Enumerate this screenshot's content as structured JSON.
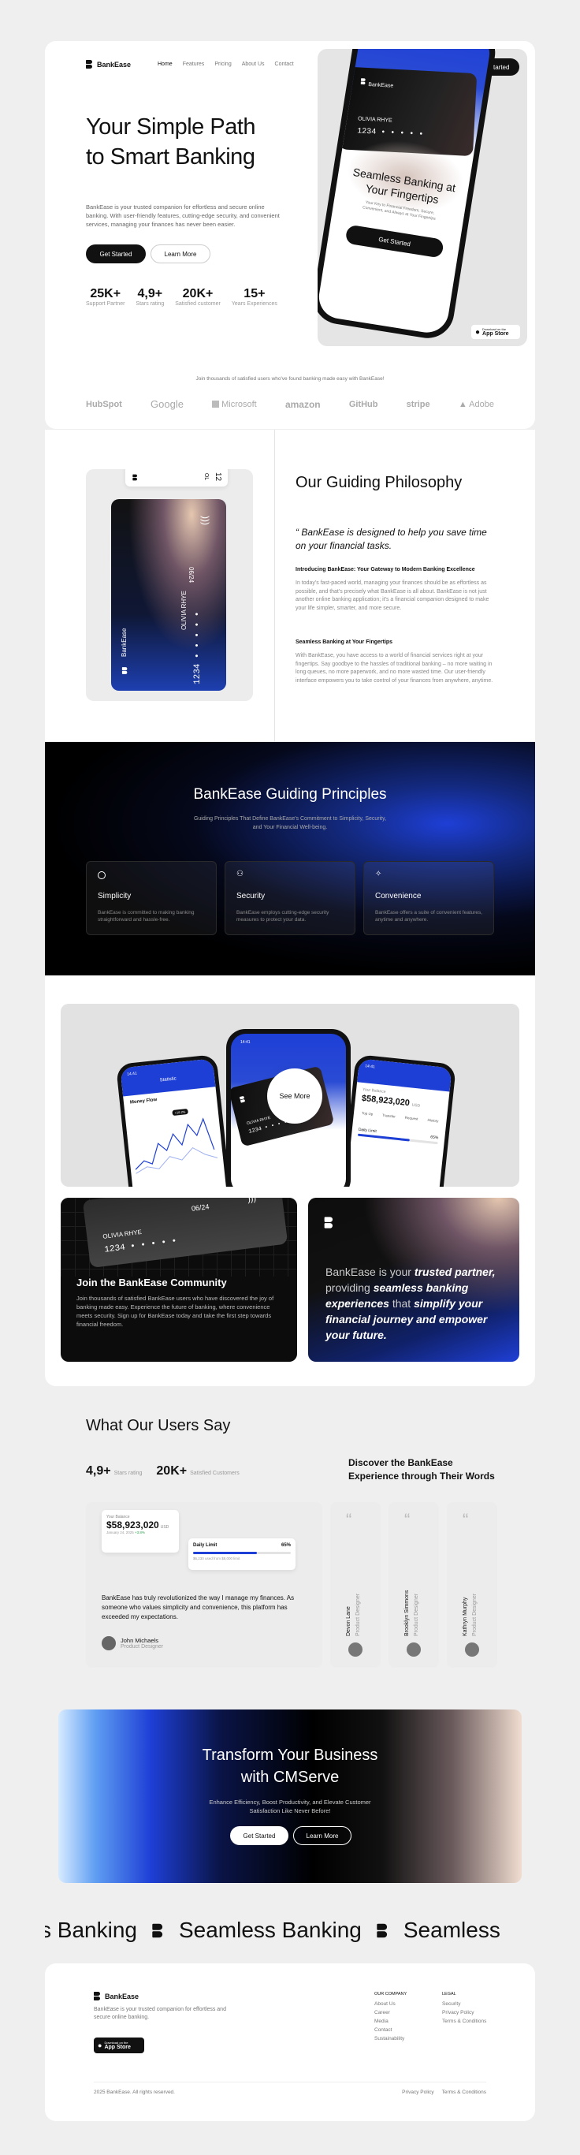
{
  "nav": {
    "brand": "BankEase",
    "links": [
      "Home",
      "Features",
      "Pricing",
      "About Us",
      "Contact"
    ],
    "cta": "Get Started"
  },
  "hero": {
    "title_line1": "Your Simple Path",
    "title_line2": "to Smart Banking",
    "desc": "BankEase is your trusted companion for effortless and secure online banking. With user-friendly features, cutting-edge security, and convenient services, managing your finances has never been easier.",
    "btn_primary": "Get Started",
    "btn_secondary": "Learn More",
    "stats": [
      {
        "value": "25K+",
        "label": "Support Partner"
      },
      {
        "value": "4,9+",
        "label": "Stars rating"
      },
      {
        "value": "20K+",
        "label": "Satisfied customer"
      },
      {
        "value": "15+",
        "label": "Years Experiences"
      }
    ],
    "phone": {
      "brand": "BankEase",
      "card_name": "OLIVIA RHYE",
      "card_number": "1234 • • • • •",
      "heading": "Seamless Banking at Your Fingertips",
      "sub": "Your Key to Financial Freedom, Secure, Convenient, and Always at Your Fingertips",
      "btn": "Get Started"
    },
    "appstore": {
      "small": "Download on the",
      "big": "App Store"
    }
  },
  "logos": {
    "caption": "Join thousands of satisfied users who've found banking made easy with BankEase!",
    "items": [
      "HubSpot",
      "Google",
      "Microsoft",
      "amazon",
      "GitHub",
      "stripe",
      "Adobe"
    ]
  },
  "philosophy": {
    "card_date": "06/24",
    "card_name": "OLIVIA RHYE",
    "card_number": "1234 • • • • •",
    "card_brand": "BankEase",
    "top_card_num": "12",
    "top_card_code": "OL",
    "title": "Our Guiding Philosophy",
    "quote": "“ BankEase is designed to help you save time on your financial tasks.",
    "h1": "Introducing BankEase: Your Gateway to Modern Banking Excellence",
    "p1": "In today's fast-paced world, managing your finances should be as effortless as possible, and that's precisely what BankEase is all about. BankEase is not just another online banking application; it's a financial companion designed to make your life simpler, smarter, and more secure.",
    "h2": "Seamless Banking at Your Fingertips",
    "p2": "With BankEase, you have access to a world of financial services right at your fingertips. Say goodbye to the hassles of traditional banking – no more waiting in long queues, no more paperwork, and no more wasted time. Our user-friendly interface empowers you to take control of your finances from anywhere, anytime."
  },
  "principles": {
    "title": "BankEase Guiding Principles",
    "sub": "Guiding Principles That Define BankEase's Commitment to Simplicity, Security, and Your Financial Well-being.",
    "items": [
      {
        "title": "Simplicity",
        "desc": "BankEase is committed to making banking straightforward and hassle-free."
      },
      {
        "title": "Security",
        "desc": "BankEase employs cutting-edge security measures to protect your data."
      },
      {
        "title": "Convenience",
        "desc": "BankEase offers a suite of convenient features, anytime and anywhere."
      }
    ]
  },
  "showcase": {
    "see_more": "See More",
    "left_phone": {
      "time": "14:41",
      "title": "Statistic",
      "widget": "Money Flow",
      "tag": "+18.2%"
    },
    "center_phone": {
      "time": "14:41",
      "card_name": "OLIVIA RHYE",
      "card_number": "1234 • • • •"
    },
    "right_phone": {
      "time": "14:41",
      "label": "Your Balance",
      "balance": "$58,923,020",
      "currency": "USD",
      "actions": [
        "Top Up",
        "Transfer",
        "Request",
        "History"
      ],
      "daily_limit": "Daily Limit",
      "daily_pct": "65%"
    }
  },
  "community": {
    "card_date": "06/24",
    "card_name": "OLIVIA RHYE",
    "card_number": "1234 • • • • •",
    "title": "Join the BankEase Community",
    "desc": "Join thousands of satisfied BankEase users who have discovered the joy of banking made easy. Experience the future of banking, where convenience meets security. Sign up for BankEase today and take the first step towards financial freedom."
  },
  "partner": {
    "p_a": "BankEase is your ",
    "p_b": "trusted partner,",
    "p_c": " providing ",
    "p_d": "seamless banking experiences",
    "p_e": " that ",
    "p_f": "simplify your financial journey and empower your future."
  },
  "testimonials": {
    "title": "What Our Users Say",
    "stats": [
      {
        "value": "4,9+",
        "label": "Stars rating"
      },
      {
        "value": "20K+",
        "label": "Satisfied Customers"
      }
    ],
    "discover": "Discover the BankEase Experience through Their Words",
    "widget": {
      "label": "Your Balance",
      "balance": "$58,923,020",
      "currency": "USD",
      "date": "January 24, 2025",
      "change": "+3.8%",
      "limit": "Daily Limit",
      "limit_pct": "65%",
      "limit_detail": "$6,230 used from $8,000 limit"
    },
    "quote": "BankEase has truly revolutionized the way I manage my finances. As someone who values simplicity and convenience, this platform has exceeded my expectations.",
    "author": "John Michaels",
    "role": "Product Designer",
    "people": [
      {
        "name": "Devon Lane",
        "role": "Product Designer"
      },
      {
        "name": "Brooklyn Simmons",
        "role": "Product Designer"
      },
      {
        "name": "Kathryn Murphy",
        "role": "Product Designer"
      }
    ]
  },
  "cta": {
    "title_line1": "Transform Your Business",
    "title_line2": "with CMServe",
    "sub": "Enhance Efficiency, Boost Productivity, and Elevate Customer Satisfaction Like Never Before!",
    "btn_primary": "Get Started",
    "btn_secondary": "Learn More"
  },
  "marquee": {
    "t1": "s Banking",
    "t2": "Seamless Banking",
    "t3": "Seamless"
  },
  "footer": {
    "brand": "BankEase",
    "desc": "BankEase is your trusted companion for effortless and secure online banking.",
    "appstore_small": "Download on the",
    "appstore_big": "App Store",
    "col1_title": "OUR COMPANY",
    "col1": [
      "About Us",
      "Career",
      "Media",
      "Contact",
      "Sustainability"
    ],
    "col2_title": "LEGAL",
    "col2": [
      "Security",
      "Privacy Policy",
      "Terms & Conditions"
    ],
    "copyright": "2025 BankEase. All rights reserved.",
    "privacy": "Privacy Policy",
    "terms": "Terms & Conditions"
  }
}
